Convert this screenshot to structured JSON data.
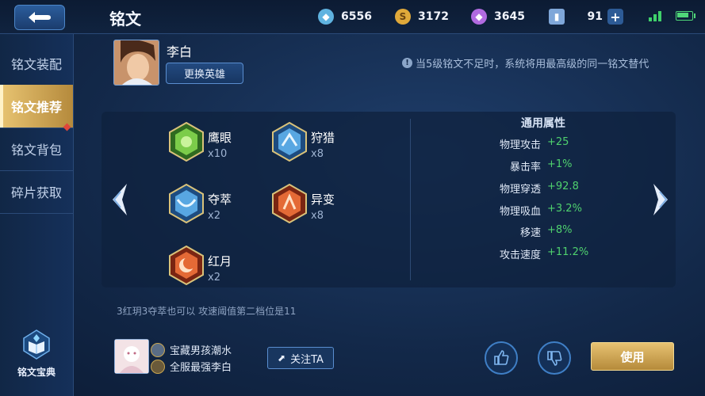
{
  "header": {
    "title": "铭文",
    "currencies": [
      {
        "icon": "diamond-gem-icon",
        "value": "6556"
      },
      {
        "icon": "gold-coin-icon",
        "value": "3172"
      },
      {
        "icon": "purple-crystal-icon",
        "value": "3645"
      },
      {
        "icon": "voucher-card-icon",
        "value": "91"
      }
    ]
  },
  "sidebar": {
    "items": [
      {
        "label": "铭文装配"
      },
      {
        "label": "铭文推荐"
      },
      {
        "label": "铭文背包"
      },
      {
        "label": "碎片获取"
      }
    ],
    "codex_label": "铭文宝典"
  },
  "hero": {
    "name": "李白",
    "change_label": "更换英雄"
  },
  "notice": "当5级铭文不足时，系统将用最高级的同一铭文替代",
  "runes": [
    {
      "name": "鹰眼",
      "count": "x10",
      "color": "#4fae3a"
    },
    {
      "name": "狩猎",
      "count": "x8",
      "color": "#3d86c7"
    },
    {
      "name": "夺萃",
      "count": "x2",
      "color": "#3d86c7"
    },
    {
      "name": "异变",
      "count": "x8",
      "color": "#d2532a"
    },
    {
      "name": "红月",
      "count": "x2",
      "color": "#d2532a"
    }
  ],
  "attributes": {
    "title": "通用属性",
    "rows": [
      {
        "name": "物理攻击",
        "value": "+25"
      },
      {
        "name": "暴击率",
        "value": "+1%"
      },
      {
        "name": "物理穿透",
        "value": "+92.8"
      },
      {
        "name": "物理吸血",
        "value": "+3.2%"
      },
      {
        "name": "移速",
        "value": "+8%"
      },
      {
        "name": "攻击速度",
        "value": "+11.2%"
      }
    ]
  },
  "comment": "3红玥3夺萃也可以 攻速阈值第二档位是11",
  "author": {
    "name": "宝藏男孩潮水",
    "title": "全服最强李白",
    "follow_label": "关注TA"
  },
  "use_label": "使用",
  "colors": {
    "accent_gold": "#e7c272",
    "value_green": "#4fd16e"
  }
}
